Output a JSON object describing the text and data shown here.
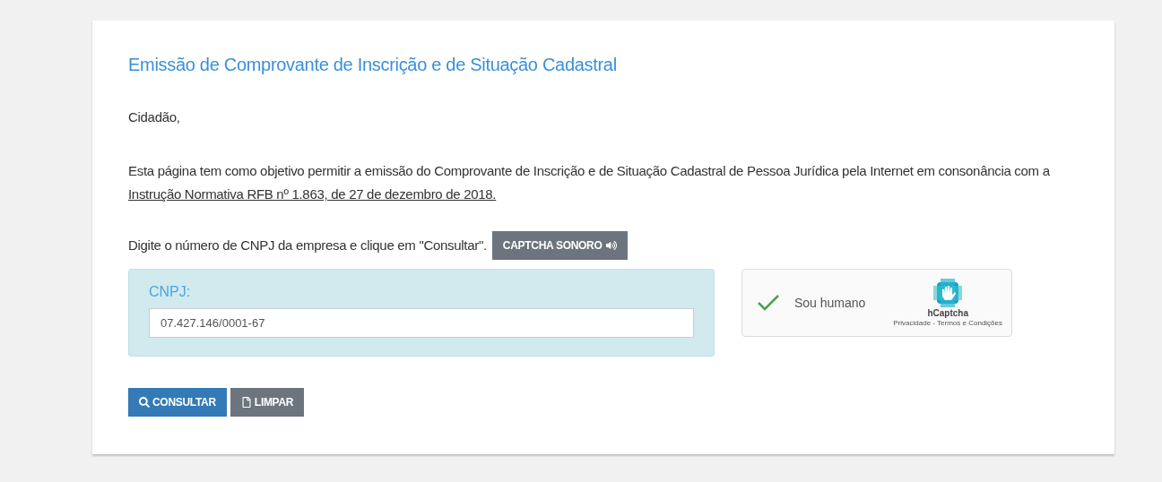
{
  "title": "Emissão de Comprovante de Inscrição e de Situação Cadastral",
  "greeting": "Cidadão,",
  "intro": {
    "text": "Esta página tem como objetivo permitir a emissão do Comprovante de Inscrição e de Situação Cadastral de Pessoa Jurídica pela Internet em consonância com a",
    "link": "Instrução Normativa RFB nº 1.863, de 27 de dezembro de 2018."
  },
  "instruction": "Digite o número de CNPJ da empresa e clique em \"Consultar\".",
  "audio_button": "CAPTCHA SONORO",
  "cnpj": {
    "label": "CNPJ:",
    "value": "07.427.146/0001-67"
  },
  "captcha": {
    "label": "Sou humano",
    "checked": true,
    "brand": "hCaptcha",
    "links": "Privacidade - Termos e Condições"
  },
  "buttons": [
    {
      "kind": "search",
      "label": "CONSULTAR"
    },
    {
      "kind": "clear",
      "label": "LIMPAR"
    }
  ]
}
